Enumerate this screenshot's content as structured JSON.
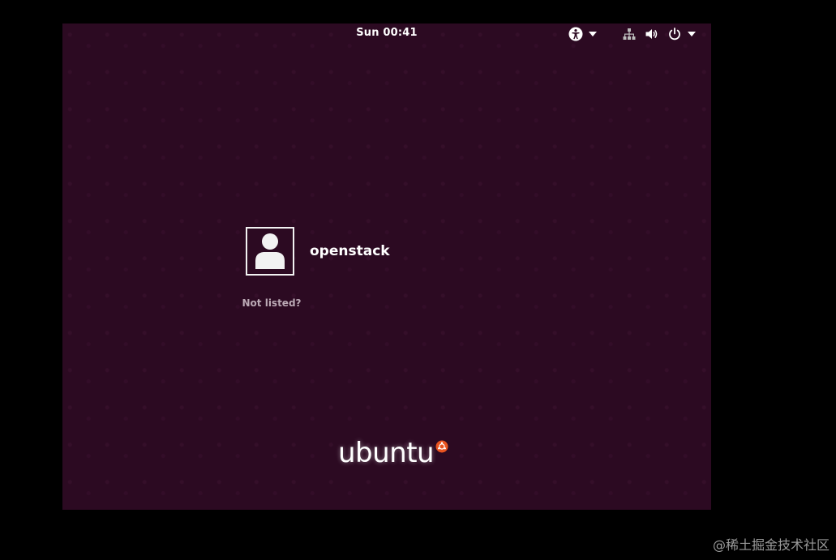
{
  "topbar": {
    "clock": "Sun 00:41",
    "accessibility_icon": "accessibility-icon",
    "network_icon": "network-wired-icon",
    "volume_icon": "volume-icon",
    "power_icon": "power-icon"
  },
  "login": {
    "username": "openstack",
    "not_listed": "Not listed?"
  },
  "branding": {
    "logo_text": "ubuntu",
    "logo_color": "#e95420"
  },
  "watermark": "@稀土掘金技术社区",
  "colors": {
    "background": "#2c0a22",
    "outer": "#000000",
    "text": "#ffffff"
  }
}
